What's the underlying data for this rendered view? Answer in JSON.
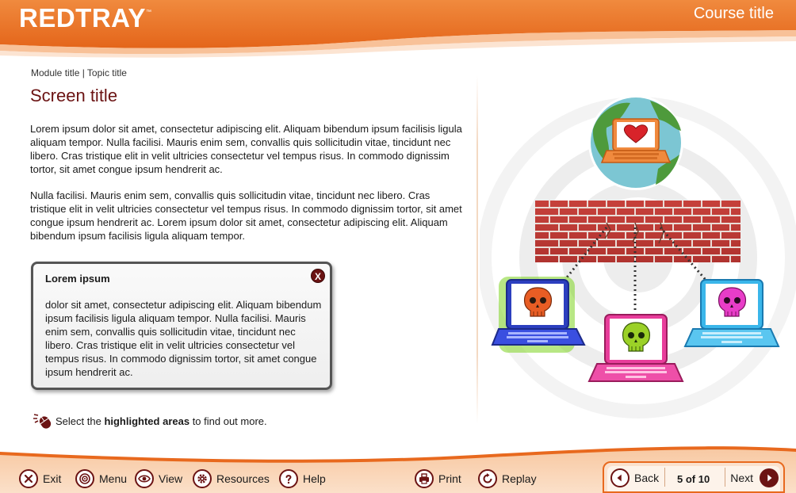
{
  "header": {
    "logo": "REDTRAY",
    "logo_tm": "™",
    "course_title": "Course title"
  },
  "content": {
    "breadcrumb": "Module title | Topic title",
    "screen_title": "Screen title",
    "paragraphs": [
      "Lorem ipsum dolor sit amet, consectetur adipiscing elit. Aliquam bibendum ipsum facilisis ligula aliquam tempor. Nulla facilisi. Mauris enim sem, convallis quis sollicitudin vitae, tincidunt nec libero. Cras tristique elit in velit ultricies consectetur vel tempus risus. In commodo dignissim tortor, sit amet congue ipsum hendrerit ac.",
      "Nulla facilisi. Mauris enim sem, convallis quis sollicitudin vitae, tincidunt nec libero. Cras tristique elit in velit ultricies consectetur vel tempus risus. In commodo dignissim tortor, sit amet congue ipsum hendrerit ac. Lorem ipsum dolor sit amet, consectetur adipiscing elit. Aliquam bibendum ipsum facilisis ligula aliquam tempor."
    ]
  },
  "popup": {
    "heading": "Lorem ipsum",
    "close_label": "X",
    "body": "dolor sit amet, consectetur adipiscing elit. Aliquam bibendum ipsum facilisis ligula aliquam tempor. Nulla facilisi. Mauris enim sem, convallis quis sollicitudin vitae, tincidunt nec libero. Cras tristique elit in velit ultricies consectetur vel tempus risus. In commodo dignissim tortor, sit amet congue ipsum hendrerit ac."
  },
  "instruction": {
    "prefix": "Select the ",
    "emphasis": "highlighted areas",
    "suffix": " to find out more.",
    "icon": "mouse-click-icon"
  },
  "illustration": {
    "icons": [
      "globe-icon",
      "heart-laptop-icon",
      "brick-firewall-icon",
      "orange-skull-laptop-icon",
      "green-skull-laptop-icon",
      "pink-skull-laptop-icon"
    ]
  },
  "footer": {
    "buttons": [
      {
        "label": "Exit",
        "icon": "close-icon"
      },
      {
        "label": "Menu",
        "icon": "target-icon"
      },
      {
        "label": "View",
        "icon": "eye-icon"
      },
      {
        "label": "Resources",
        "icon": "gear-icon"
      },
      {
        "label": "Help",
        "icon": "question-icon"
      },
      {
        "label": "Print",
        "icon": "printer-icon"
      },
      {
        "label": "Replay",
        "icon": "replay-icon"
      }
    ],
    "nav": {
      "back": "Back",
      "page": "5 of 10",
      "next": "Next"
    }
  },
  "colors": {
    "brand_orange": "#e8691e",
    "accent_maroon": "#6b1313",
    "title_color": "#6b1313"
  }
}
